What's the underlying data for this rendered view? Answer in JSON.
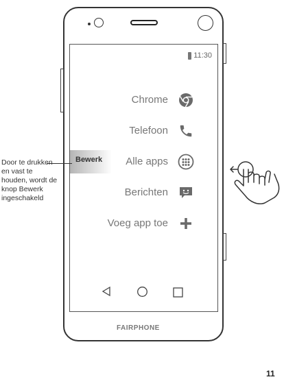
{
  "status_bar": {
    "time": "11:30"
  },
  "menu": {
    "items": [
      {
        "label": "Chrome",
        "icon": "chrome-icon"
      },
      {
        "label": "Telefoon",
        "icon": "phone-icon"
      },
      {
        "label": "Alle apps",
        "icon": "all-apps-icon"
      },
      {
        "label": "Berichten",
        "icon": "messages-icon"
      },
      {
        "label": "Voeg app toe",
        "icon": "plus-icon"
      }
    ],
    "edit_label": "Bewerk"
  },
  "nav_bar": {
    "icons": [
      "back-icon",
      "home-icon",
      "recents-icon"
    ]
  },
  "brand": "FAIRPHONE",
  "callout": "Door te drukken en vast te houden, wordt de knop Bewerk ingeschakeld",
  "page_number": "11",
  "gesture": {
    "icon": "swipe-left-hand-icon"
  }
}
